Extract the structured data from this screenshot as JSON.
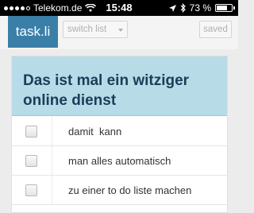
{
  "status_bar": {
    "carrier": "Telekom.de",
    "time": "15:48",
    "battery": "73 %",
    "battery_level": 0.73,
    "signal_bars_filled": 4,
    "icons": [
      "wifi-icon",
      "location-arrow-icon",
      "bluetooth-icon",
      "battery-icon"
    ]
  },
  "toolbar": {
    "logo": "task.li",
    "switch_list": "switch list",
    "saved": "saved"
  },
  "list": {
    "title": "Das ist mal ein witziger online dienst",
    "items": [
      {
        "text": "damit  kann",
        "checked": false
      },
      {
        "text": "man alles automatisch",
        "checked": false
      },
      {
        "text": "zu einer to do liste machen",
        "checked": false
      }
    ]
  },
  "colors": {
    "logo_bg": "#3a7fa8",
    "title_bg": "#b8dbe8",
    "title_text": "#1d3d57"
  }
}
